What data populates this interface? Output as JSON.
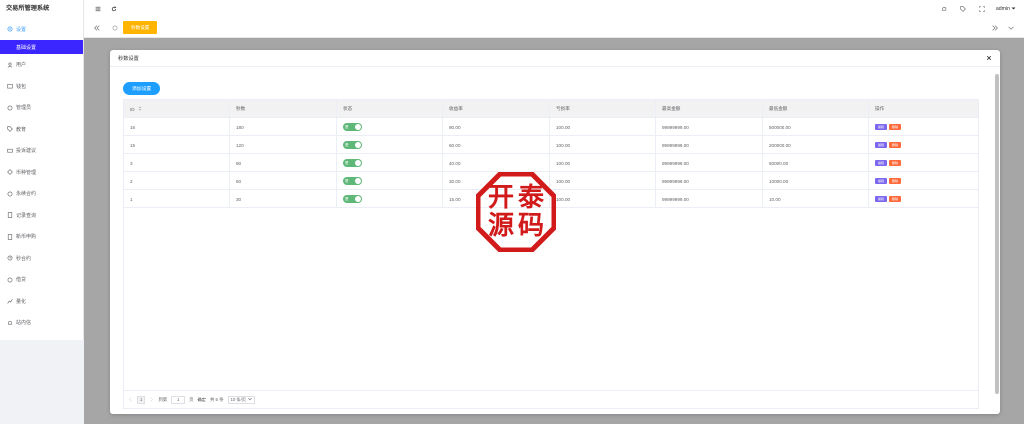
{
  "app": {
    "title": "交易所管理系统"
  },
  "sidebar": {
    "items": [
      {
        "label": "设置",
        "icon": "gear-icon"
      },
      {
        "label": "基础设置",
        "icon": ""
      },
      {
        "label": "用户",
        "icon": "user-icon"
      },
      {
        "label": "钱包",
        "icon": "wallet-icon"
      },
      {
        "label": "管理员",
        "icon": "admin-icon"
      },
      {
        "label": "教育",
        "icon": "tag-icon"
      },
      {
        "label": "投诉建议",
        "icon": "message-icon"
      },
      {
        "label": "币种管理",
        "icon": "coin-icon"
      },
      {
        "label": "永续合约",
        "icon": "contract-icon"
      },
      {
        "label": "记录查询",
        "icon": "record-icon"
      },
      {
        "label": "新币申购",
        "icon": "purchase-icon"
      },
      {
        "label": "秒合约",
        "icon": "clock-icon"
      },
      {
        "label": "借贷",
        "icon": "loan-icon"
      },
      {
        "label": "量化",
        "icon": "quant-icon"
      },
      {
        "label": "站内信",
        "icon": "mail-icon"
      }
    ]
  },
  "topbar": {
    "user": "admin"
  },
  "tags": {
    "active": "秒数设置"
  },
  "dialog": {
    "title": "秒数设置",
    "add_button": "添加设置",
    "columns": [
      "ID",
      "秒数",
      "状态",
      "收益率",
      "亏损率",
      "最高金额",
      "最低金额",
      "操作"
    ],
    "switch_label": "是",
    "edit_label": "编辑",
    "delete_label": "删除",
    "rows": [
      {
        "id": "16",
        "seconds": "180",
        "profit": "90.00",
        "loss": "100.00",
        "max": "99999999.00",
        "min": "500000.00"
      },
      {
        "id": "15",
        "seconds": "120",
        "profit": "60.00",
        "loss": "100.00",
        "max": "99999999.00",
        "min": "200000.00"
      },
      {
        "id": "3",
        "seconds": "90",
        "profit": "40.00",
        "loss": "100.00",
        "max": "99999999.00",
        "min": "50000.00"
      },
      {
        "id": "2",
        "seconds": "60",
        "profit": "30.00",
        "loss": "100.00",
        "max": "99999999.00",
        "min": "10000.00"
      },
      {
        "id": "1",
        "seconds": "30",
        "profit": "15.00",
        "loss": "100.00",
        "max": "99999999.00",
        "min": "10.00"
      }
    ],
    "pager": {
      "current": "1",
      "goto_label": "到第",
      "goto_value": "1",
      "page_unit": "页",
      "confirm": "确定",
      "total": "共 5 条",
      "page_size": "10 条/页"
    }
  },
  "stamp": {
    "chars": [
      "开",
      "泰",
      "源",
      "码"
    ]
  },
  "colors": {
    "accent": "#3c26ff",
    "tag": "#ffb400",
    "add_button": "#1e9fff",
    "switch_on": "#5fb878",
    "edit": "#7b68ee",
    "delete": "#ff6a3d",
    "stamp": "#d11a1a"
  }
}
